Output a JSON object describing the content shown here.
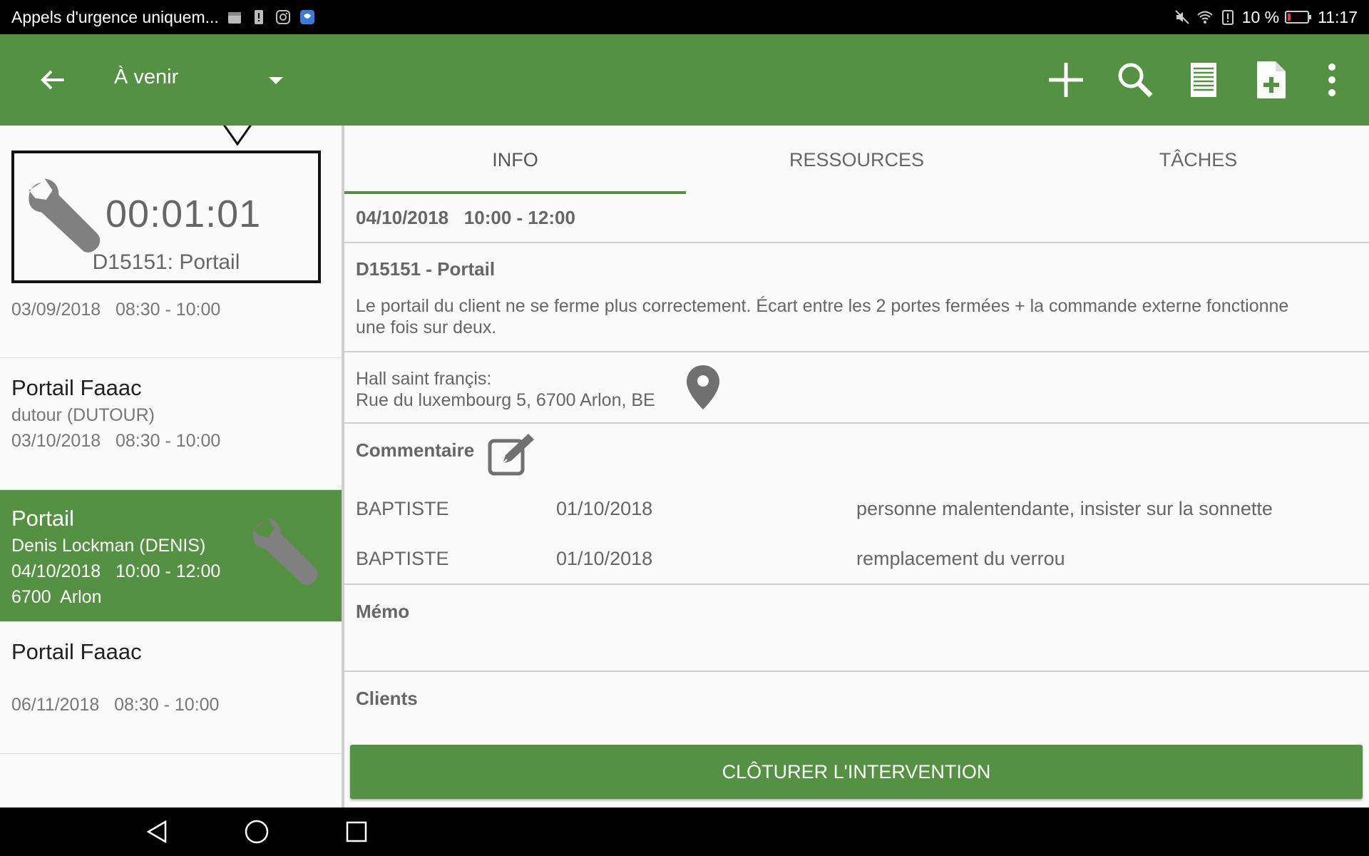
{
  "status_bar": {
    "left_text": "Appels d'urgence uniquem...",
    "battery": "10 %",
    "time": "11:17"
  },
  "app_bar": {
    "filter_label": "À venir",
    "icons": [
      "back-arrow-icon",
      "dropdown-icon",
      "add-icon",
      "search-icon",
      "list-icon",
      "add-document-icon",
      "more-icon"
    ]
  },
  "timer": {
    "elapsed": "00:01:01",
    "job": "D15151: Portail"
  },
  "list": {
    "items": [
      {
        "title": "",
        "subtitle": "",
        "date": "03/09/2018   08:30 - 10:00",
        "city": ""
      },
      {
        "title": "Portail Faaac",
        "subtitle": "dutour (DUTOUR)",
        "date": "03/10/2018   08:30 - 10:00",
        "city": ""
      },
      {
        "title": "Portail",
        "subtitle": "Denis Lockman (DENIS)",
        "date": "04/10/2018   10:00 - 12:00",
        "city": "6700  Arlon",
        "selected": true
      },
      {
        "title": "Portail Faaac",
        "subtitle": "",
        "date": "06/11/2018   08:30 - 10:00",
        "city": ""
      }
    ]
  },
  "tabs": [
    "INFO",
    "RESSOURCES",
    "TÂCHES"
  ],
  "detail": {
    "date_time": "04/10/2018   10:00 - 12:00",
    "job_title": "D15151 - Portail",
    "description_line1": "Le portail du client ne se ferme plus correctement. Écart entre les 2 portes fermées + la commande externe fonctionne",
    "description_line2": "une fois sur deux.",
    "location_name": "Hall saint françis:",
    "address": "Rue du luxembourg 5, 6700 Arlon, BE",
    "comment_label": "Commentaire",
    "comments": [
      {
        "author": "BAPTISTE",
        "date": "01/10/2018",
        "text": "personne malentendante, insister sur la sonnette"
      },
      {
        "author": "BAPTISTE",
        "date": "01/10/2018",
        "text": "remplacement du verrou"
      }
    ],
    "memo_label": "Mémo",
    "clients_label": "Clients",
    "close_button": "CLÔTURER L'INTERVENTION"
  },
  "colors": {
    "primary": "#559142",
    "status_bg": "#000000"
  }
}
